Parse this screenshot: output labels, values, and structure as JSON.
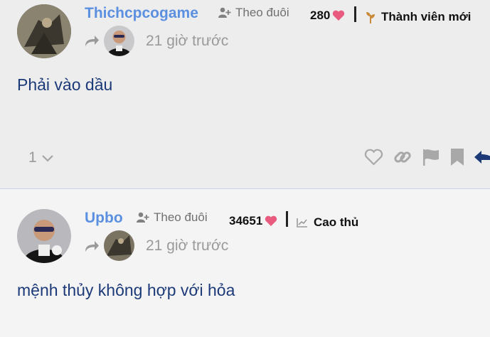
{
  "posts": [
    {
      "username": "Thichcpcogame",
      "follow_label": "Theo đuôi",
      "likes": "280",
      "rank": "Thành viên mới",
      "time": "21 giờ trước",
      "content": "Phải vào dầu",
      "reply_count": "1"
    },
    {
      "username": "Upbo",
      "follow_label": "Theo đuôi",
      "likes": "34651",
      "rank": "Cao thủ",
      "time": "21 giờ trước",
      "content": "mệnh thủy không hợp với hỏa"
    }
  ],
  "colors": {
    "username": "#5b8fe0",
    "heart": "#e85a7e",
    "content": "#1c3a78",
    "reply_arrow": "#1c3a78"
  }
}
